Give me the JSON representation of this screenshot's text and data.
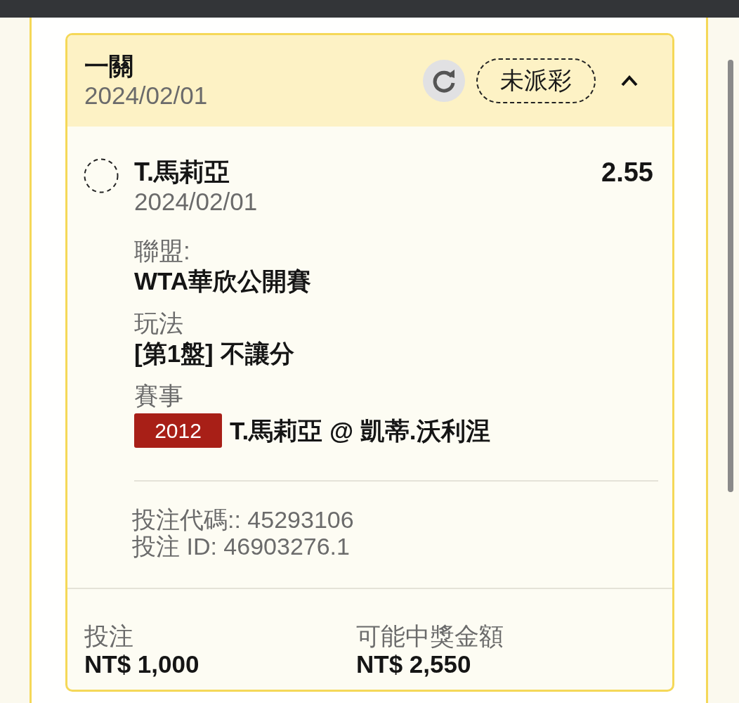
{
  "bet": {
    "title": "一關",
    "date": "2024/02/01",
    "status": "未派彩",
    "expanded": true
  },
  "selection": {
    "name": "T.馬莉亞",
    "date": "2024/02/01",
    "odds": "2.55",
    "details": [
      {
        "kind": "text",
        "label": "聯盟:",
        "value": "WTA華欣公開賽"
      },
      {
        "kind": "text",
        "label": "玩法",
        "value": "[第1盤] 不讓分"
      },
      {
        "kind": "event",
        "label": "賽事",
        "code": "2012",
        "value": "T.馬莉亞 @ 凱蒂.沃利涅"
      }
    ],
    "references": [
      "投注代碼:: 45293106",
      "投注 ID: 46903276.1"
    ]
  },
  "totals": [
    {
      "label": "投注",
      "value": "NT$ 1,000"
    },
    {
      "label": "可能中獎金額",
      "value": "NT$ 2,550"
    }
  ]
}
